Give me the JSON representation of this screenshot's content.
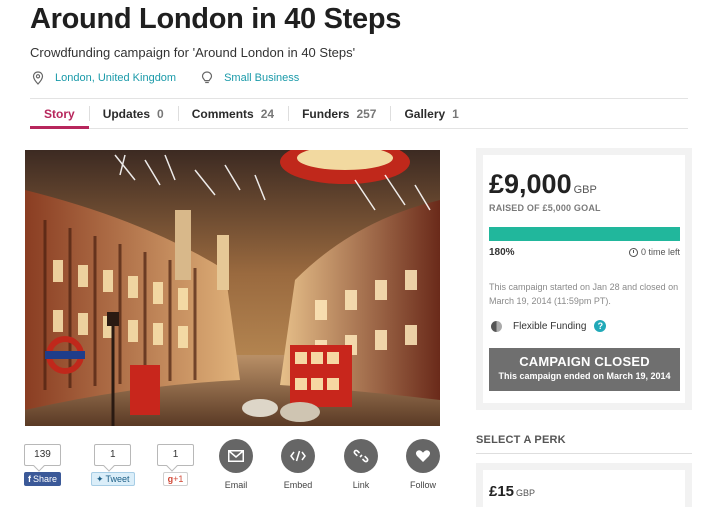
{
  "campaign": {
    "title": "Around London in 40 Steps",
    "subtitle": "Crowdfunding campaign for 'Around London in 40 Steps'",
    "location": "London, United Kingdom",
    "category": "Small Business"
  },
  "tabs": [
    {
      "label": "Story",
      "count": ""
    },
    {
      "label": "Updates",
      "count": "0"
    },
    {
      "label": "Comments",
      "count": "24"
    },
    {
      "label": "Funders",
      "count": "257"
    },
    {
      "label": "Gallery",
      "count": "1"
    }
  ],
  "share": {
    "facebook": {
      "count": "139",
      "label": "Share"
    },
    "twitter": {
      "count": "1",
      "label": "Tweet"
    },
    "gplus": {
      "count": "1",
      "label": "+1"
    },
    "actions": [
      {
        "label": "Email",
        "icon": "envelope-icon"
      },
      {
        "label": "Embed",
        "icon": "code-icon"
      },
      {
        "label": "Link",
        "icon": "link-icon"
      },
      {
        "label": "Follow",
        "icon": "heart-icon"
      }
    ]
  },
  "funding": {
    "amount": "£9,000",
    "currency": "GBP",
    "goal_text": "RAISED OF £5,000 GOAL",
    "percent": "180%",
    "progress_fraction": 1.0,
    "time_left": "0 time left",
    "started_text": "This campaign started on Jan 28 and closed on March 19, 2014 (11:59pm PT).",
    "funding_type": "Flexible Funding",
    "help": "?",
    "closed_title": "CAMPAIGN CLOSED",
    "closed_subtitle": "This campaign ended on March 19, 2014"
  },
  "perks": {
    "heading": "SELECT A PERK",
    "items": [
      {
        "amount": "£15",
        "currency": "GBP"
      }
    ]
  },
  "colors": {
    "accent": "#b7265c",
    "link": "#1a9aa9",
    "progress": "#21b79c",
    "closed_bg": "#6f6f6f",
    "action_circle": "#666666"
  }
}
